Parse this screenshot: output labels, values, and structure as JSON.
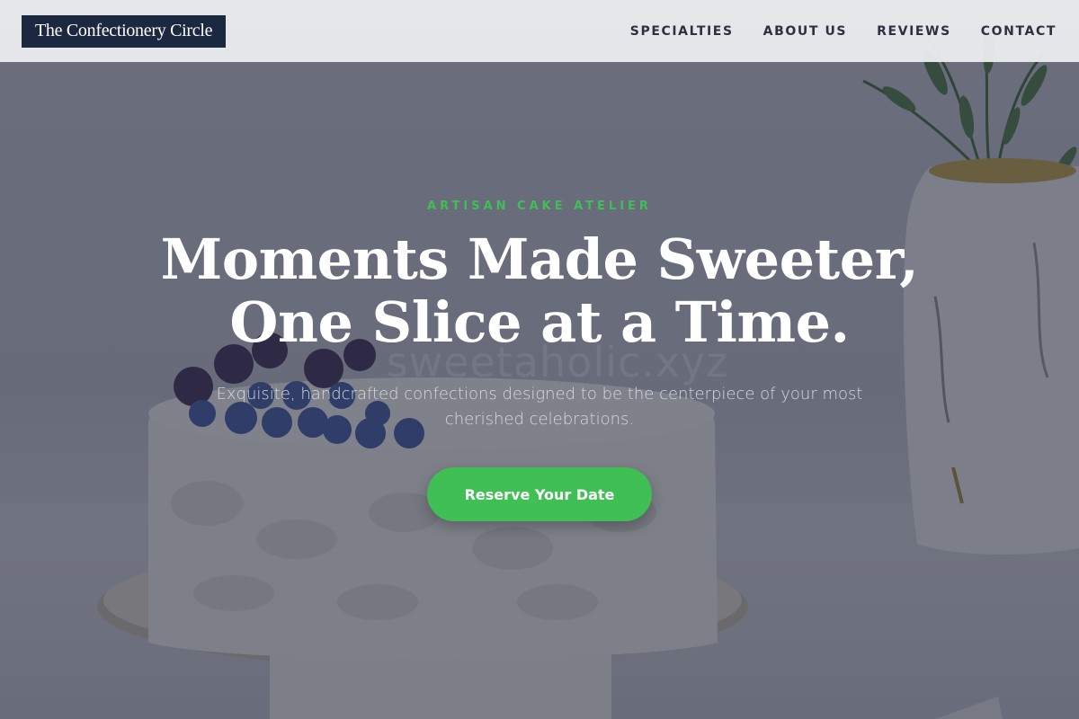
{
  "header": {
    "logo": "The Confectionery Circle",
    "nav": [
      "SPECIALTIES",
      "ABOUT US",
      "REVIEWS",
      "CONTACT"
    ]
  },
  "hero": {
    "eyebrow": "ARTISAN CAKE ATELIER",
    "headline_line1": "Moments Made Sweeter,",
    "headline_line2": "One Slice at a Time.",
    "subtext": "Exquisite, handcrafted confections designed to be the centerpiece of your most cherished celebrations.",
    "cta": "Reserve Your Date",
    "watermark": "sweetaholic.xyz"
  },
  "colors": {
    "accent": "#40bf55",
    "logo_bg": "#1c2840",
    "header_bg": "#ecedef"
  },
  "background_image": {
    "icons": [
      "cake-image",
      "vase-image",
      "berries-image",
      "plant-image"
    ]
  }
}
